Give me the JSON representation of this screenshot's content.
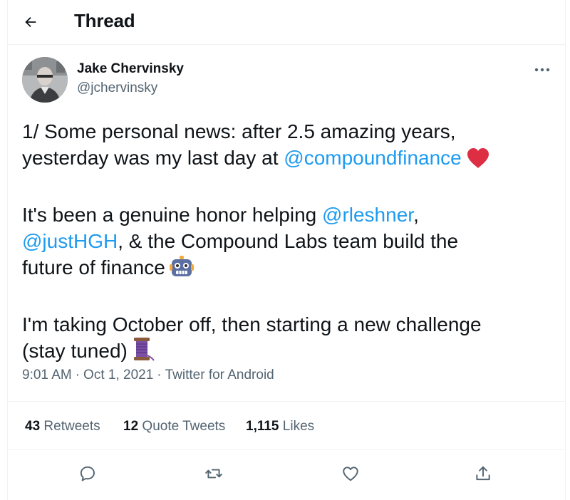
{
  "header": {
    "back_icon": "arrow-left-icon",
    "title": "Thread"
  },
  "author": {
    "name": "Jake Chervinsky",
    "handle": "@jchervinsky",
    "more_icon": "more-horizontal-icon"
  },
  "tweet": {
    "p1_text_a": "1/ Some personal news: after 2.5 amazing years,",
    "p1_text_b": "yesterday was my last day at ",
    "p1_mention": "@compoundfinance",
    "p1_emoji": "heart-emoji",
    "p2_text_a": "It's been a genuine honor helping ",
    "p2_mention_1": "@rleshner",
    "p2_comma": ",",
    "p2_mention_2": "@justHGH",
    "p2_text_b": ", & the Compound Labs team build the",
    "p2_text_c": "future of finance",
    "p2_emoji": "robot-emoji",
    "p3_text_a": "I'm taking October off, then starting a new challenge",
    "p3_text_b": "(stay tuned)",
    "p3_emoji": "thread-spool-emoji"
  },
  "meta": {
    "time": "9:01 AM",
    "separator": "·",
    "date": "Oct 1, 2021",
    "source": "Twitter for Android"
  },
  "stats": {
    "retweets_count": "43",
    "retweets_label": "Retweets",
    "quotes_count": "12",
    "quotes_label": "Quote Tweets",
    "likes_count": "1,115",
    "likes_label": "Likes"
  },
  "actions": {
    "reply_icon": "reply-icon",
    "retweet_icon": "retweet-icon",
    "like_icon": "like-icon",
    "share_icon": "share-icon"
  },
  "colors": {
    "link": "#1d9bf0",
    "secondary_text": "#536471",
    "primary_text": "#0f1419",
    "border": "#eff3f4"
  }
}
